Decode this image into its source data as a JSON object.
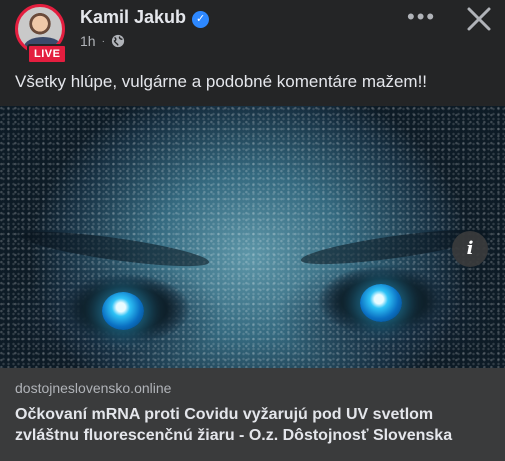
{
  "post": {
    "author": "Kamil Jakub",
    "verified": true,
    "live_badge": "LIVE",
    "time": "1h",
    "privacy_icon": "globe-icon",
    "caption": "Všetky hlúpe, vulgárne a podobné komentáre mažem!!"
  },
  "controls": {
    "more_icon": "more-options-icon",
    "more_glyph": "•••",
    "close_icon": "close-icon"
  },
  "media": {
    "info_label": "i"
  },
  "link": {
    "domain": "dostojneslovensko.online",
    "title": "Očkovaní mRNA proti Covidu vyžarujú pod UV svetlom zvláštnu fluorescenčnú žiaru - O.z. Dôstojnosť Slovenska"
  },
  "colors": {
    "background": "#242526",
    "live": "#e41e3f",
    "verified": "#2d88ff",
    "link_card": "#3a3b3c"
  }
}
